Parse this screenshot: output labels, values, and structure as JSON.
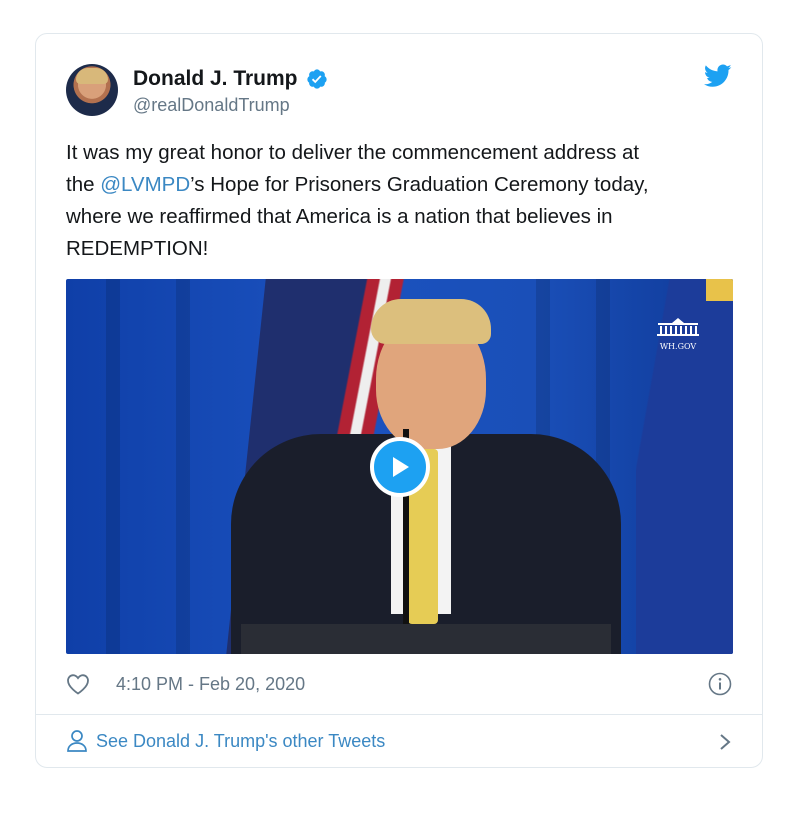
{
  "tweet": {
    "author_name": "Donald J. Trump",
    "handle": "@realDonaldTrump",
    "text_before": "It was my great honor to deliver the commencement address at\nthe ",
    "mention": "@LVMPD",
    "text_after": "’s Hope for Prisoners Graduation Ceremony today,\nwhere we reaffirmed that America is a nation that believes in\nREDEMPTION!",
    "timestamp": "4:10 PM - Feb 20, 2020",
    "media": {
      "type": "video",
      "watermark": "WH.GOV",
      "play_icon": "play-icon"
    }
  },
  "footer": {
    "link_label": "See Donald J. Trump's other Tweets"
  },
  "icons": {
    "verified": "verified-badge-icon",
    "twitter": "twitter-bird-icon",
    "like": "heart-icon",
    "info": "info-icon",
    "profile": "person-icon",
    "chevron": "chevron-right-icon"
  },
  "colors": {
    "accent": "#1da1f2",
    "link": "#3b88c3",
    "secondary_text": "#657786",
    "border": "#e1e8ed"
  }
}
